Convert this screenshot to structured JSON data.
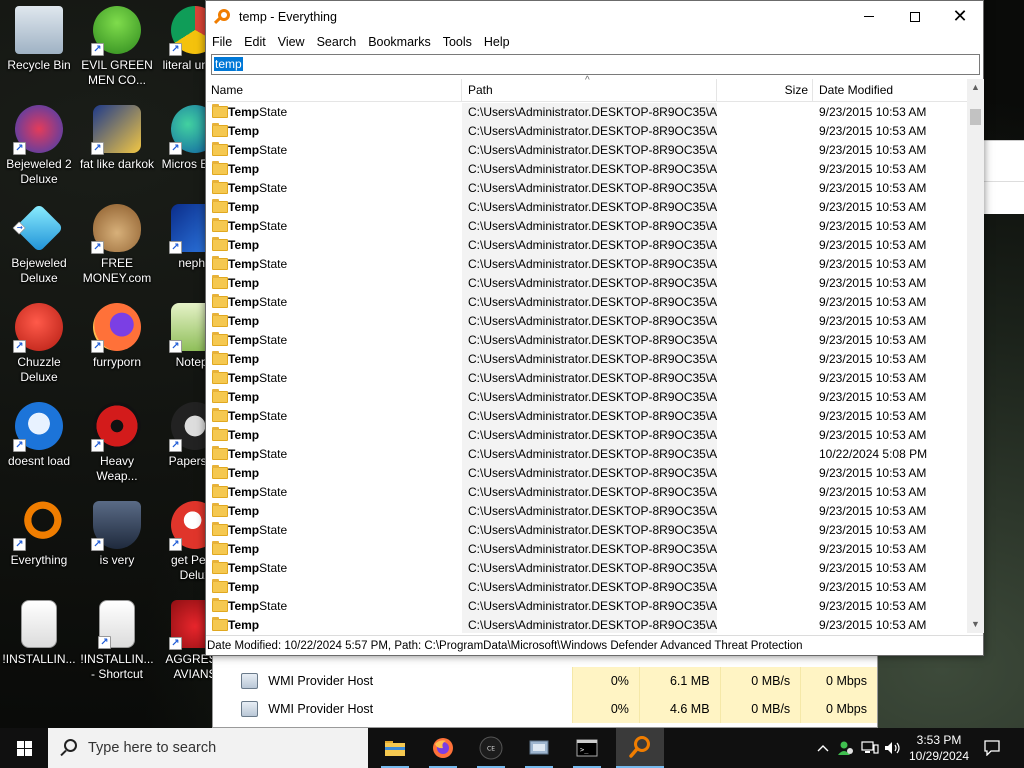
{
  "desktop": {
    "icons": [
      {
        "label": "Recycle Bin",
        "icon": "recycle-bin-icon"
      },
      {
        "label": "EVIL GREEN MEN CO...",
        "icon": "green-men-icon"
      },
      {
        "label": "literal unusa",
        "icon": "chrome-icon"
      },
      {
        "label": "Bejeweled 2 Deluxe",
        "icon": "bejeweled2-icon"
      },
      {
        "label": "fat like darkok",
        "icon": "mpl-icon"
      },
      {
        "label": "Micros Edge",
        "icon": "edge-icon"
      },
      {
        "label": "Bejeweled Deluxe",
        "icon": "diamond-icon"
      },
      {
        "label": "FREE MONEY.com",
        "icon": "money-bag-icon"
      },
      {
        "label": "nepha",
        "icon": "mpl-blue-icon"
      },
      {
        "label": "Chuzzle Deluxe",
        "icon": "chuzzle-icon"
      },
      {
        "label": "furryporn",
        "icon": "firefox-icon"
      },
      {
        "label": "Notepa",
        "icon": "notepad-icon"
      },
      {
        "label": "doesnt load",
        "icon": "thunderbird-icon"
      },
      {
        "label": "Heavy Weap...",
        "icon": "radiation-icon"
      },
      {
        "label": "Papers, P",
        "icon": "papers-icon"
      },
      {
        "label": "Everything",
        "icon": "everything-icon"
      },
      {
        "label": "is very",
        "icon": "mpl-shield-icon"
      },
      {
        "label": "get Pegg Delux",
        "icon": "peggle-icon"
      },
      {
        "label": "!INSTALLIN...",
        "icon": "document-icon"
      },
      {
        "label": "!INSTALLIN... - Shortcut",
        "icon": "document-shortcut-icon"
      },
      {
        "label": "AGGRESS AVIANS",
        "icon": "angry-birds-icon"
      }
    ]
  },
  "task_manager": {
    "rows": [
      {
        "name": "WMI Provider Host",
        "cpu": "0%",
        "memory": "6.1 MB",
        "disk": "0 MB/s",
        "network": "0 Mbps"
      },
      {
        "name": "WMI Provider Host",
        "cpu": "0%",
        "memory": "4.6 MB",
        "disk": "0 MB/s",
        "network": "0 Mbps"
      }
    ]
  },
  "everything": {
    "title": "temp - Everything",
    "menu": [
      "File",
      "Edit",
      "View",
      "Search",
      "Bookmarks",
      "Tools",
      "Help"
    ],
    "search_value": "temp",
    "columns": {
      "name": "Name",
      "path": "Path",
      "size": "Size",
      "date": "Date Modified"
    },
    "rows": [
      {
        "bold": "Temp",
        "rest": "State",
        "path": "C:\\Users\\Administrator.DESKTOP-8R9OC35\\A...",
        "date": "9/23/2015 10:53 AM"
      },
      {
        "bold": "Temp",
        "rest": "",
        "path": "C:\\Users\\Administrator.DESKTOP-8R9OC35\\A...",
        "date": "9/23/2015 10:53 AM"
      },
      {
        "bold": "Temp",
        "rest": "State",
        "path": "C:\\Users\\Administrator.DESKTOP-8R9OC35\\A...",
        "date": "9/23/2015 10:53 AM"
      },
      {
        "bold": "Temp",
        "rest": "",
        "path": "C:\\Users\\Administrator.DESKTOP-8R9OC35\\A...",
        "date": "9/23/2015 10:53 AM"
      },
      {
        "bold": "Temp",
        "rest": "State",
        "path": "C:\\Users\\Administrator.DESKTOP-8R9OC35\\A...",
        "date": "9/23/2015 10:53 AM"
      },
      {
        "bold": "Temp",
        "rest": "",
        "path": "C:\\Users\\Administrator.DESKTOP-8R9OC35\\A...",
        "date": "9/23/2015 10:53 AM"
      },
      {
        "bold": "Temp",
        "rest": "State",
        "path": "C:\\Users\\Administrator.DESKTOP-8R9OC35\\A...",
        "date": "9/23/2015 10:53 AM"
      },
      {
        "bold": "Temp",
        "rest": "",
        "path": "C:\\Users\\Administrator.DESKTOP-8R9OC35\\A...",
        "date": "9/23/2015 10:53 AM"
      },
      {
        "bold": "Temp",
        "rest": "State",
        "path": "C:\\Users\\Administrator.DESKTOP-8R9OC35\\A...",
        "date": "9/23/2015 10:53 AM"
      },
      {
        "bold": "Temp",
        "rest": "",
        "path": "C:\\Users\\Administrator.DESKTOP-8R9OC35\\A...",
        "date": "9/23/2015 10:53 AM"
      },
      {
        "bold": "Temp",
        "rest": "State",
        "path": "C:\\Users\\Administrator.DESKTOP-8R9OC35\\A...",
        "date": "9/23/2015 10:53 AM"
      },
      {
        "bold": "Temp",
        "rest": "",
        "path": "C:\\Users\\Administrator.DESKTOP-8R9OC35\\A...",
        "date": "9/23/2015 10:53 AM"
      },
      {
        "bold": "Temp",
        "rest": "State",
        "path": "C:\\Users\\Administrator.DESKTOP-8R9OC35\\A...",
        "date": "9/23/2015 10:53 AM"
      },
      {
        "bold": "Temp",
        "rest": "",
        "path": "C:\\Users\\Administrator.DESKTOP-8R9OC35\\A...",
        "date": "9/23/2015 10:53 AM"
      },
      {
        "bold": "Temp",
        "rest": "State",
        "path": "C:\\Users\\Administrator.DESKTOP-8R9OC35\\A...",
        "date": "9/23/2015 10:53 AM"
      },
      {
        "bold": "Temp",
        "rest": "",
        "path": "C:\\Users\\Administrator.DESKTOP-8R9OC35\\A...",
        "date": "9/23/2015 10:53 AM"
      },
      {
        "bold": "Temp",
        "rest": "State",
        "path": "C:\\Users\\Administrator.DESKTOP-8R9OC35\\A...",
        "date": "9/23/2015 10:53 AM"
      },
      {
        "bold": "Temp",
        "rest": "",
        "path": "C:\\Users\\Administrator.DESKTOP-8R9OC35\\A...",
        "date": "9/23/2015 10:53 AM"
      },
      {
        "bold": "Temp",
        "rest": "State",
        "path": "C:\\Users\\Administrator.DESKTOP-8R9OC35\\A...",
        "date": "10/22/2024 5:08 PM"
      },
      {
        "bold": "Temp",
        "rest": "",
        "path": "C:\\Users\\Administrator.DESKTOP-8R9OC35\\A...",
        "date": "9/23/2015 10:53 AM"
      },
      {
        "bold": "Temp",
        "rest": "State",
        "path": "C:\\Users\\Administrator.DESKTOP-8R9OC35\\A...",
        "date": "9/23/2015 10:53 AM"
      },
      {
        "bold": "Temp",
        "rest": "",
        "path": "C:\\Users\\Administrator.DESKTOP-8R9OC35\\A...",
        "date": "9/23/2015 10:53 AM"
      },
      {
        "bold": "Temp",
        "rest": "State",
        "path": "C:\\Users\\Administrator.DESKTOP-8R9OC35\\A...",
        "date": "9/23/2015 10:53 AM"
      },
      {
        "bold": "Temp",
        "rest": "",
        "path": "C:\\Users\\Administrator.DESKTOP-8R9OC35\\A...",
        "date": "9/23/2015 10:53 AM"
      },
      {
        "bold": "Temp",
        "rest": "State",
        "path": "C:\\Users\\Administrator.DESKTOP-8R9OC35\\A...",
        "date": "9/23/2015 10:53 AM"
      },
      {
        "bold": "Temp",
        "rest": "",
        "path": "C:\\Users\\Administrator.DESKTOP-8R9OC35\\A...",
        "date": "9/23/2015 10:53 AM"
      },
      {
        "bold": "Temp",
        "rest": "State",
        "path": "C:\\Users\\Administrator.DESKTOP-8R9OC35\\A...",
        "date": "9/23/2015 10:53 AM"
      },
      {
        "bold": "Temp",
        "rest": "",
        "path": "C:\\Users\\Administrator.DESKTOP-8R9OC35\\A...",
        "date": "9/23/2015 10:53 AM"
      }
    ],
    "status": "Date Modified: 10/22/2024 5:57 PM, Path: C:\\ProgramData\\Microsoft\\Windows Defender Advanced Threat Protection"
  },
  "taskbar": {
    "search_placeholder": "Type here to search",
    "apps": [
      "file-explorer-icon",
      "firefox-icon",
      "cheatengine-icon",
      "control-panel-icon",
      "command-prompt-icon",
      "everything-icon"
    ],
    "time": "3:53 PM",
    "date": "10/29/2024"
  },
  "colors": {
    "accent": "#0078d7",
    "everything_orange": "#f07d00",
    "folder": "#f5c850",
    "taskbar": "#101010"
  }
}
